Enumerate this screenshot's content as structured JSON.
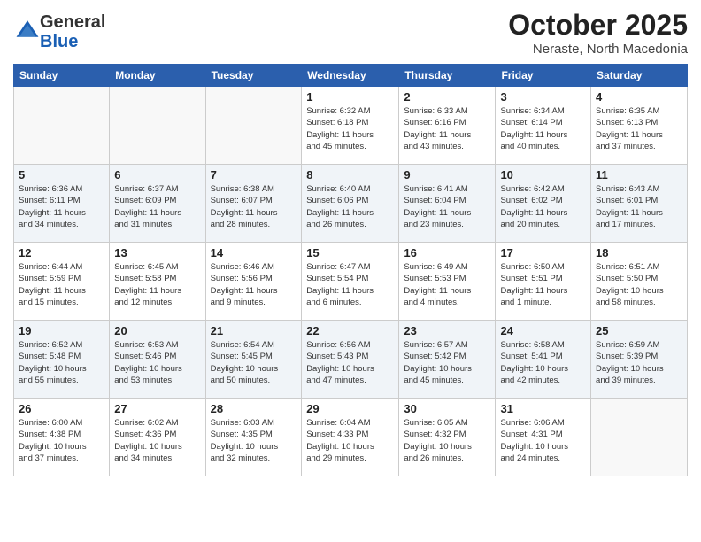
{
  "header": {
    "logo_general": "General",
    "logo_blue": "Blue",
    "month_title": "October 2025",
    "location": "Neraste, North Macedonia"
  },
  "weekdays": [
    "Sunday",
    "Monday",
    "Tuesday",
    "Wednesday",
    "Thursday",
    "Friday",
    "Saturday"
  ],
  "weeks": [
    [
      {
        "day": "",
        "info": ""
      },
      {
        "day": "",
        "info": ""
      },
      {
        "day": "",
        "info": ""
      },
      {
        "day": "1",
        "info": "Sunrise: 6:32 AM\nSunset: 6:18 PM\nDaylight: 11 hours\nand 45 minutes."
      },
      {
        "day": "2",
        "info": "Sunrise: 6:33 AM\nSunset: 6:16 PM\nDaylight: 11 hours\nand 43 minutes."
      },
      {
        "day": "3",
        "info": "Sunrise: 6:34 AM\nSunset: 6:14 PM\nDaylight: 11 hours\nand 40 minutes."
      },
      {
        "day": "4",
        "info": "Sunrise: 6:35 AM\nSunset: 6:13 PM\nDaylight: 11 hours\nand 37 minutes."
      }
    ],
    [
      {
        "day": "5",
        "info": "Sunrise: 6:36 AM\nSunset: 6:11 PM\nDaylight: 11 hours\nand 34 minutes."
      },
      {
        "day": "6",
        "info": "Sunrise: 6:37 AM\nSunset: 6:09 PM\nDaylight: 11 hours\nand 31 minutes."
      },
      {
        "day": "7",
        "info": "Sunrise: 6:38 AM\nSunset: 6:07 PM\nDaylight: 11 hours\nand 28 minutes."
      },
      {
        "day": "8",
        "info": "Sunrise: 6:40 AM\nSunset: 6:06 PM\nDaylight: 11 hours\nand 26 minutes."
      },
      {
        "day": "9",
        "info": "Sunrise: 6:41 AM\nSunset: 6:04 PM\nDaylight: 11 hours\nand 23 minutes."
      },
      {
        "day": "10",
        "info": "Sunrise: 6:42 AM\nSunset: 6:02 PM\nDaylight: 11 hours\nand 20 minutes."
      },
      {
        "day": "11",
        "info": "Sunrise: 6:43 AM\nSunset: 6:01 PM\nDaylight: 11 hours\nand 17 minutes."
      }
    ],
    [
      {
        "day": "12",
        "info": "Sunrise: 6:44 AM\nSunset: 5:59 PM\nDaylight: 11 hours\nand 15 minutes."
      },
      {
        "day": "13",
        "info": "Sunrise: 6:45 AM\nSunset: 5:58 PM\nDaylight: 11 hours\nand 12 minutes."
      },
      {
        "day": "14",
        "info": "Sunrise: 6:46 AM\nSunset: 5:56 PM\nDaylight: 11 hours\nand 9 minutes."
      },
      {
        "day": "15",
        "info": "Sunrise: 6:47 AM\nSunset: 5:54 PM\nDaylight: 11 hours\nand 6 minutes."
      },
      {
        "day": "16",
        "info": "Sunrise: 6:49 AM\nSunset: 5:53 PM\nDaylight: 11 hours\nand 4 minutes."
      },
      {
        "day": "17",
        "info": "Sunrise: 6:50 AM\nSunset: 5:51 PM\nDaylight: 11 hours\nand 1 minute."
      },
      {
        "day": "18",
        "info": "Sunrise: 6:51 AM\nSunset: 5:50 PM\nDaylight: 10 hours\nand 58 minutes."
      }
    ],
    [
      {
        "day": "19",
        "info": "Sunrise: 6:52 AM\nSunset: 5:48 PM\nDaylight: 10 hours\nand 55 minutes."
      },
      {
        "day": "20",
        "info": "Sunrise: 6:53 AM\nSunset: 5:46 PM\nDaylight: 10 hours\nand 53 minutes."
      },
      {
        "day": "21",
        "info": "Sunrise: 6:54 AM\nSunset: 5:45 PM\nDaylight: 10 hours\nand 50 minutes."
      },
      {
        "day": "22",
        "info": "Sunrise: 6:56 AM\nSunset: 5:43 PM\nDaylight: 10 hours\nand 47 minutes."
      },
      {
        "day": "23",
        "info": "Sunrise: 6:57 AM\nSunset: 5:42 PM\nDaylight: 10 hours\nand 45 minutes."
      },
      {
        "day": "24",
        "info": "Sunrise: 6:58 AM\nSunset: 5:41 PM\nDaylight: 10 hours\nand 42 minutes."
      },
      {
        "day": "25",
        "info": "Sunrise: 6:59 AM\nSunset: 5:39 PM\nDaylight: 10 hours\nand 39 minutes."
      }
    ],
    [
      {
        "day": "26",
        "info": "Sunrise: 6:00 AM\nSunset: 4:38 PM\nDaylight: 10 hours\nand 37 minutes."
      },
      {
        "day": "27",
        "info": "Sunrise: 6:02 AM\nSunset: 4:36 PM\nDaylight: 10 hours\nand 34 minutes."
      },
      {
        "day": "28",
        "info": "Sunrise: 6:03 AM\nSunset: 4:35 PM\nDaylight: 10 hours\nand 32 minutes."
      },
      {
        "day": "29",
        "info": "Sunrise: 6:04 AM\nSunset: 4:33 PM\nDaylight: 10 hours\nand 29 minutes."
      },
      {
        "day": "30",
        "info": "Sunrise: 6:05 AM\nSunset: 4:32 PM\nDaylight: 10 hours\nand 26 minutes."
      },
      {
        "day": "31",
        "info": "Sunrise: 6:06 AM\nSunset: 4:31 PM\nDaylight: 10 hours\nand 24 minutes."
      },
      {
        "day": "",
        "info": ""
      }
    ]
  ]
}
